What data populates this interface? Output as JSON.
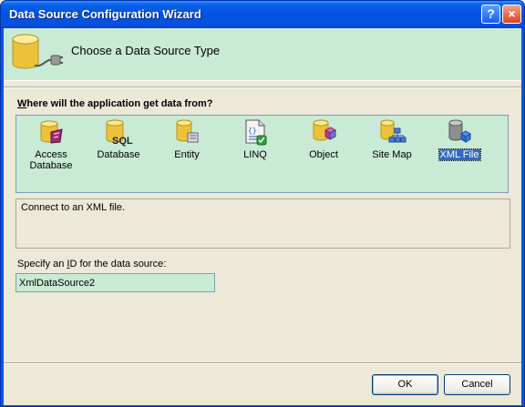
{
  "window": {
    "title": "Data Source Configuration Wizard",
    "help_label": "?",
    "close_label": "×"
  },
  "header": {
    "title": "Choose a Data Source Type"
  },
  "source_types": {
    "prompt_prefix": "",
    "prompt_accel": "W",
    "prompt_rest": "here will the application get data from?",
    "items": [
      {
        "label_line1": "Access",
        "label_line2": "Database",
        "icon": "access-database-icon"
      },
      {
        "label_line1": "Database",
        "label_line2": "",
        "icon": "database-sql-icon"
      },
      {
        "label_line1": "Entity",
        "label_line2": "",
        "icon": "entity-icon"
      },
      {
        "label_line1": "LINQ",
        "label_line2": "",
        "icon": "linq-icon"
      },
      {
        "label_line1": "Object",
        "label_line2": "",
        "icon": "object-icon"
      },
      {
        "label_line1": "Site Map",
        "label_line2": "",
        "icon": "site-map-icon"
      },
      {
        "label_line1": "XML File",
        "label_line2": "",
        "icon": "xml-file-icon",
        "selected": true
      }
    ],
    "selected_description": "Connect to an XML file."
  },
  "data_source_id": {
    "label_prefix": "Specify an ",
    "label_accel": "I",
    "label_rest": "D for the data source:",
    "value": "XmlDataSource2"
  },
  "buttons": {
    "ok": "OK",
    "cancel": "Cancel"
  },
  "colors": {
    "titlebar": "#0a55e4",
    "header_band": "#c9ead5",
    "dialog_bg": "#ece9d8",
    "selection": "#316ac5"
  }
}
